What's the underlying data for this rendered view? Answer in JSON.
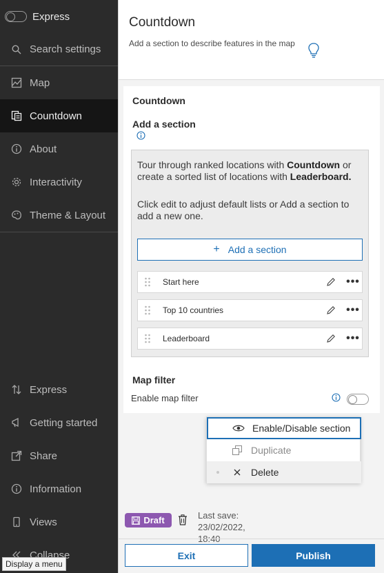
{
  "sidebar": {
    "toggle_label": "Express",
    "search_label": "Search settings",
    "items": [
      {
        "label": "Map",
        "icon": "map-icon"
      },
      {
        "label": "Countdown",
        "icon": "countdown-icon",
        "active": true
      },
      {
        "label": "About",
        "icon": "info-icon"
      },
      {
        "label": "Interactivity",
        "icon": "gear-icon"
      },
      {
        "label": "Theme & Layout",
        "icon": "palette-icon"
      }
    ],
    "bottom_items": [
      {
        "label": "Express",
        "icon": "sort-arrows-icon"
      },
      {
        "label": "Getting started",
        "icon": "megaphone-icon"
      },
      {
        "label": "Share",
        "icon": "share-icon"
      },
      {
        "label": "Information",
        "icon": "info-icon"
      },
      {
        "label": "Views",
        "icon": "phone-icon"
      },
      {
        "label": "Collapse",
        "icon": "collapse-icon"
      }
    ],
    "tooltip": "Display a menu"
  },
  "header": {
    "title": "Countdown",
    "description": "Add a section to describe features in the map"
  },
  "card": {
    "title": "Countdown",
    "section_title": "Add a section",
    "intro_parts": [
      "Tour through ranked locations with ",
      "Countdown",
      " or create a sorted list of locations with ",
      "Leaderboard."
    ],
    "help_text": "Click edit to adjust default lists or Add a section to add a new one.",
    "add_button": "Add a section",
    "sections": [
      "Start here",
      "Top 10 countries",
      "Leaderboard"
    ],
    "map_filter_title": "Map filter",
    "map_filter_label": "Enable map filter",
    "map_filter_enabled": false
  },
  "menu": {
    "items": [
      {
        "label": "Enable/Disable section",
        "icon": "eye-icon"
      },
      {
        "label": "Duplicate",
        "icon": "duplicate-icon",
        "disabled": true
      },
      {
        "label": "Delete",
        "icon": "x-icon"
      }
    ]
  },
  "footer": {
    "draft_label": "Draft",
    "last_save_label": "Last save:",
    "last_save_value": "23/02/2022, 18:40",
    "exit_label": "Exit",
    "publish_label": "Publish"
  },
  "colors": {
    "accent": "#1d6fb5",
    "draft": "#8d58b0",
    "sidebar_bg": "#2b2b2b",
    "sidebar_active": "#151515"
  }
}
